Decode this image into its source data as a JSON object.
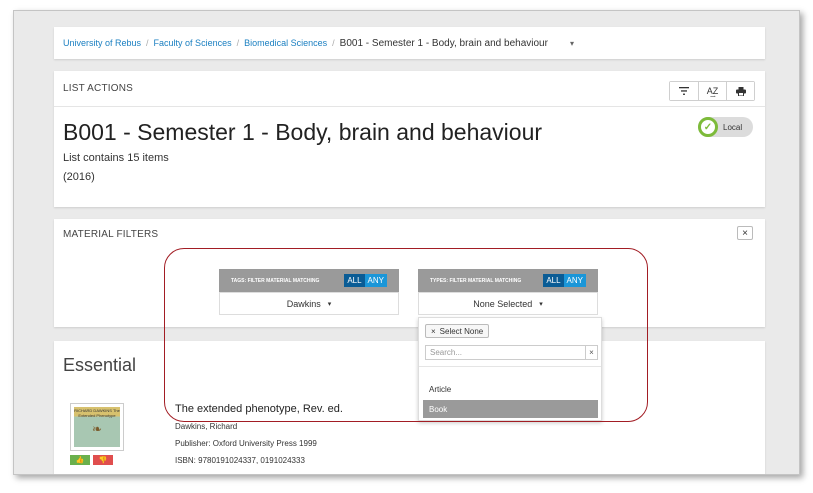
{
  "breadcrumb": {
    "items": [
      "University of Rebus",
      "Faculty of Sciences",
      "Biomedical Sciences"
    ],
    "separator": "/",
    "current": "B001 - Semester 1 - Body, brain and behaviour",
    "caret": "▾"
  },
  "list_actions": {
    "header": "LIST ACTIONS",
    "tools": [
      "filter-icon",
      "sort-az-icon",
      "print-icon"
    ],
    "sort_label": "A͢Z",
    "title": "B001 - Semester 1 - Body, brain and behaviour",
    "count": "List contains 15 items",
    "year": "(2016)",
    "local_label": "Local",
    "local_status_color": "#7dbb3a"
  },
  "material_filters": {
    "header": "MATERIAL FILTERS",
    "close": "×",
    "tags": {
      "label": "TAGS: FILTER MATERIAL MATCHING",
      "all": "ALL",
      "any": "ANY",
      "selected": "Dawkins",
      "caret": "▾"
    },
    "types": {
      "label": "TYPES: FILTER MATERIAL MATCHING",
      "all": "ALL",
      "any": "ANY",
      "selected": "None Selected",
      "caret": "▾"
    }
  },
  "dropdown": {
    "select_none_x": "×",
    "select_none": "Select None",
    "search_placeholder": "Search...",
    "clear": "×",
    "options": [
      "Article",
      "Book"
    ],
    "highlighted": "Book"
  },
  "essential": {
    "heading": "Essential",
    "cover_text": "RICHARD DAWKINS The Extended Phenotype",
    "item": {
      "title": "The extended phenotype, Rev. ed.",
      "author": "Dawkins, Richard",
      "publisher": "Publisher: Oxford University Press 1999",
      "isbn": "ISBN: 9780191024337, 0191024333"
    }
  },
  "colors": {
    "link": "#1a7fc1",
    "toggle_active": "#0a5c95",
    "toggle": "#1a96d8",
    "annotation": "#a21d24"
  }
}
